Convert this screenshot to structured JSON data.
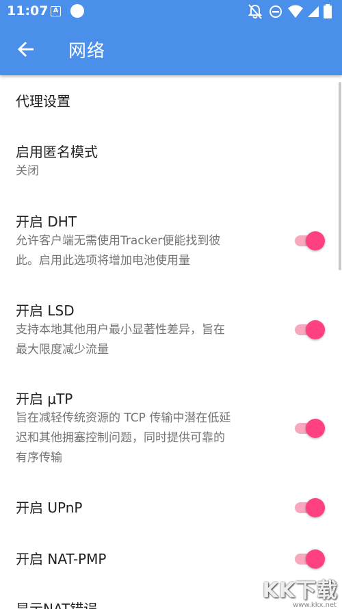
{
  "status_bar": {
    "time": "11:07",
    "notification_letter": "A"
  },
  "header": {
    "title": "网络",
    "back_icon": "arrow-left-icon"
  },
  "preferences": [
    {
      "title": "代理设置",
      "summary": ""
    },
    {
      "title": "启用匿名模式",
      "summary": "关闭"
    },
    {
      "title": "开启 DHT",
      "summary_lines": [
        "允许客户端无需使用Tracker便能找到彼",
        "此。启用此选项将增加电池使用量"
      ],
      "checked": true
    },
    {
      "title": "开启 LSD",
      "summary_lines": [
        "支持本地其他用户最小显著性差异，旨在",
        "最大限度减少流量"
      ],
      "checked": true
    },
    {
      "title": "开启 μTP",
      "summary_lines": [
        "旨在减轻传统资源的 TCP 传输中潜在低延",
        "迟和其他拥塞控制问题，同时提供可靠的",
        "有序传输"
      ],
      "checked": true
    },
    {
      "title": "开启 UPnP",
      "checked": true
    },
    {
      "title": "开启 NAT-PMP",
      "checked": true
    },
    {
      "title": "显示NAT错误"
    }
  ],
  "watermark": {
    "text": "KK下载",
    "sub": "www.kkx.net"
  },
  "colors": {
    "app_bar": "#4a90ea",
    "accent": "#ff4081",
    "switch_track": "#f7a8bf"
  }
}
